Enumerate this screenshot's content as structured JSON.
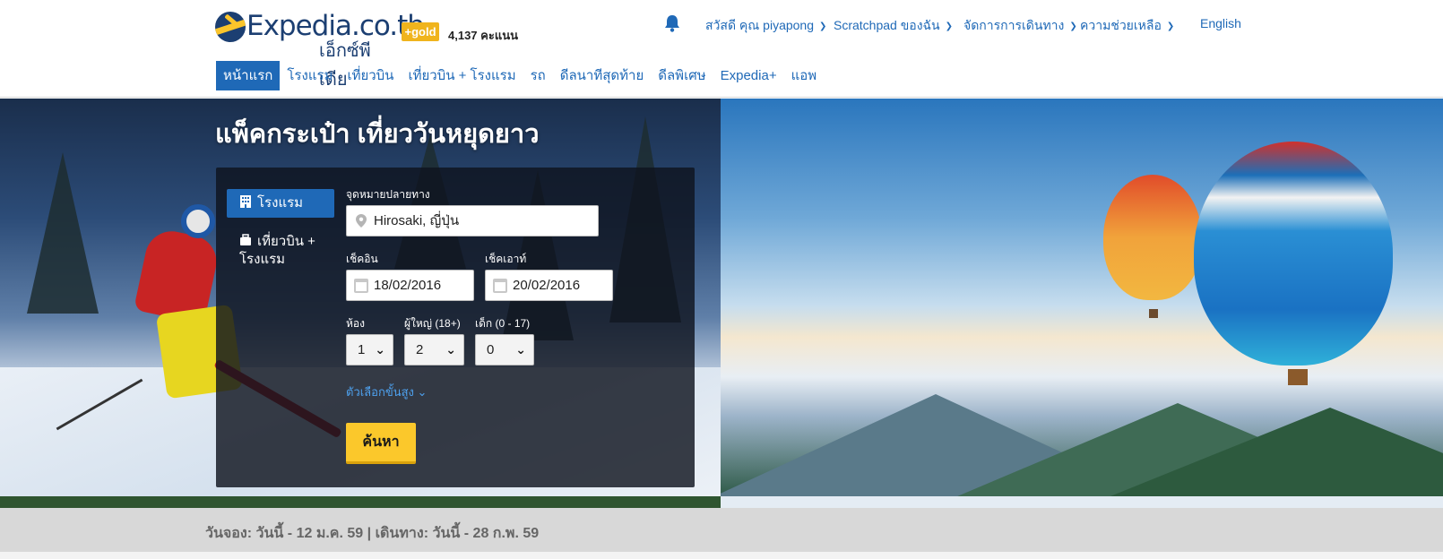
{
  "brand": {
    "name": "Expedia.co.th",
    "sub": "เอ็กซ์พีเดีย",
    "gold_badge": "+gold",
    "points": "4,137 คะแนน"
  },
  "topnav": {
    "greeting": "สวัสดี คุณ piyapong",
    "scratchpad": "Scratchpad ของฉัน",
    "manage_trips": "จัดการการเดินทาง",
    "help": "ความช่วยเหลือ",
    "language": "English"
  },
  "mainnav": [
    "หน้าแรก",
    "โรงแรม",
    "เที่ยวบิน",
    "เที่ยวบิน + โรงแรม",
    "รถ",
    "ดีลนาทีสุดท้าย",
    "ดีลพิเศษ",
    "Expedia+",
    "แอพ"
  ],
  "hero": {
    "title": "แพ็คกระเป๋า เที่ยววันหยุดยาว"
  },
  "search": {
    "tabs": {
      "hotels": "โรงแรม",
      "flight_hotel": "เที่ยวบิน + โรงแรม"
    },
    "destination_label": "จุดหมายปลายทาง",
    "destination_value": "Hirosaki, ญี่ปุ่น",
    "checkin_label": "เช็คอิน",
    "checkin_value": "18/02/2016",
    "checkout_label": "เช็คเอาท์",
    "checkout_value": "20/02/2016",
    "rooms_label": "ห้อง",
    "rooms_value": "1",
    "adults_label": "ผู้ใหญ่ (18+)",
    "adults_value": "2",
    "children_label": "เด็ก (0 - 17)",
    "children_value": "0",
    "advanced": "ตัวเลือกขั้นสูง",
    "submit": "ค้นหา"
  },
  "promo": {
    "dates": "วันจอง: วันนี้ - 12 ม.ค. 59 | เดินทาง: วันนี้ - 28 ก.พ. 59"
  },
  "colors": {
    "brand_blue": "#1f69b7",
    "navy": "#1c3f72",
    "gold": "#f0b41d",
    "search_button": "#fbc82b"
  }
}
